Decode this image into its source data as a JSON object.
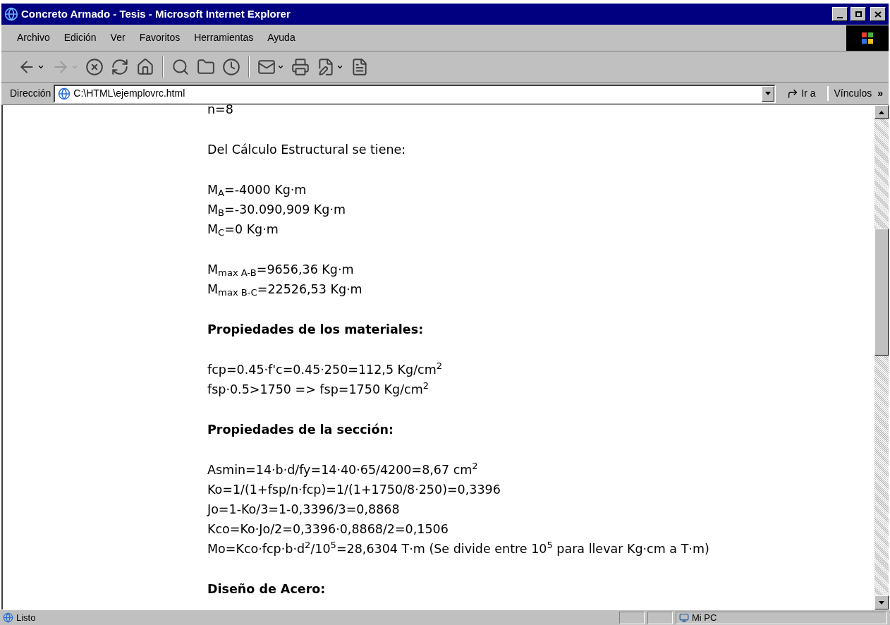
{
  "window": {
    "title": "Concreto Armado - Tesis - Microsoft Internet Explorer"
  },
  "menu": [
    "Archivo",
    "Edición",
    "Ver",
    "Favoritos",
    "Herramientas",
    "Ayuda"
  ],
  "toolbar": [
    {
      "kind": "back",
      "disabled": false,
      "dropdown": true
    },
    {
      "kind": "forward",
      "disabled": true,
      "dropdown": true
    },
    {
      "kind": "stop",
      "disabled": false,
      "dropdown": false
    },
    {
      "kind": "refresh",
      "disabled": false,
      "dropdown": false
    },
    {
      "kind": "home",
      "disabled": false,
      "dropdown": false
    },
    {
      "kind": "separator"
    },
    {
      "kind": "search",
      "disabled": false,
      "dropdown": false
    },
    {
      "kind": "favorites",
      "disabled": false,
      "dropdown": false
    },
    {
      "kind": "history",
      "disabled": false,
      "dropdown": false
    },
    {
      "kind": "separator"
    },
    {
      "kind": "mail",
      "disabled": false,
      "dropdown": true
    },
    {
      "kind": "print",
      "disabled": false,
      "dropdown": false
    },
    {
      "kind": "edit",
      "disabled": false,
      "dropdown": true
    },
    {
      "kind": "discuss",
      "disabled": false,
      "dropdown": false
    }
  ],
  "address_bar": {
    "label": "Dirección",
    "value": "C:\\HTML\\ejemplovrc.html",
    "go": "Ir a",
    "links": "Vínculos",
    "more": "»"
  },
  "document": [
    {
      "kind": "text",
      "lines": [
        "n=8"
      ]
    },
    {
      "kind": "text",
      "lines": [
        "Del Cálculo Estructural se tiene:"
      ]
    },
    {
      "kind": "text",
      "lines": [
        "M$_{A}$=-4000 Kg·m",
        "M$_{B}$=-30.090,909 Kg·m",
        "M$_{C}$=0 Kg·m"
      ]
    },
    {
      "kind": "text",
      "lines": [
        "M$_{max A-B}$=9656,36 Kg·m",
        "M$_{max B-C}$=22526,53 Kg·m"
      ]
    },
    {
      "kind": "heading",
      "lines": [
        "Propiedades de los materiales:"
      ]
    },
    {
      "kind": "text",
      "lines": [
        "fcp=0.45·f'c=0.45·250=112,5 Kg/cm$^{2}$",
        "fsp·0.5>1750 => fsp=1750 Kg/cm$^{2}$"
      ]
    },
    {
      "kind": "heading",
      "lines": [
        "Propiedades de la sección:"
      ]
    },
    {
      "kind": "text",
      "lines": [
        "Asmin=14·b·d/fy=14·40·65/4200=8,67 cm$^{2}$",
        "Ko=1/(1+fsp/n·fcp)=1/(1+1750/8·250)=0,3396",
        "Jo=1-Ko/3=1-0,3396/3=0,8868",
        "Kco=Ko·Jo/2=0,3396·0,8868/2=0,1506",
        "Mo=Kco·fcp·b·d$^{2}$/10$^{5}$=28,6304 T·m (Se divide entre 10$^{5}$ para llevar Kg·cm a T·m)"
      ]
    },
    {
      "kind": "heading",
      "lines": [
        "Diseño de Acero:"
      ]
    }
  ],
  "status_bar": {
    "text": "Listo",
    "zone": "Mi PC"
  }
}
